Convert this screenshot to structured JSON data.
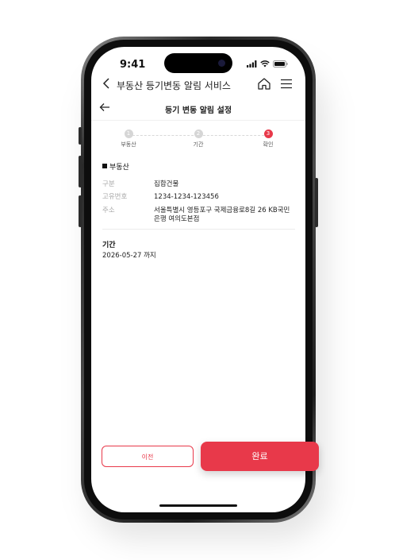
{
  "status_bar": {
    "time": "9:41"
  },
  "header": {
    "title": "부동산 등기변동 알림 서비스"
  },
  "subheader": {
    "title": "등기 변동 알림 설정"
  },
  "steps": [
    {
      "number": "1",
      "label": "부동산"
    },
    {
      "number": "2",
      "label": "기간"
    },
    {
      "number": "3",
      "label": "확인"
    }
  ],
  "property": {
    "section_title": "부동산",
    "rows": [
      {
        "label": "구분",
        "value": "집합건물"
      },
      {
        "label": "고유번호",
        "value": "1234-1234-123456"
      },
      {
        "label": "주소",
        "value": "서울특별시 영등포구 국제금융로8길 26 KB국민은행 여의도본점"
      }
    ]
  },
  "period": {
    "label": "기간",
    "value": "2026-05-27 까지"
  },
  "buttons": {
    "prev": "이전",
    "done": "완료"
  },
  "colors": {
    "accent": "#e8394a",
    "step_inactive": "#d6d6d6"
  }
}
